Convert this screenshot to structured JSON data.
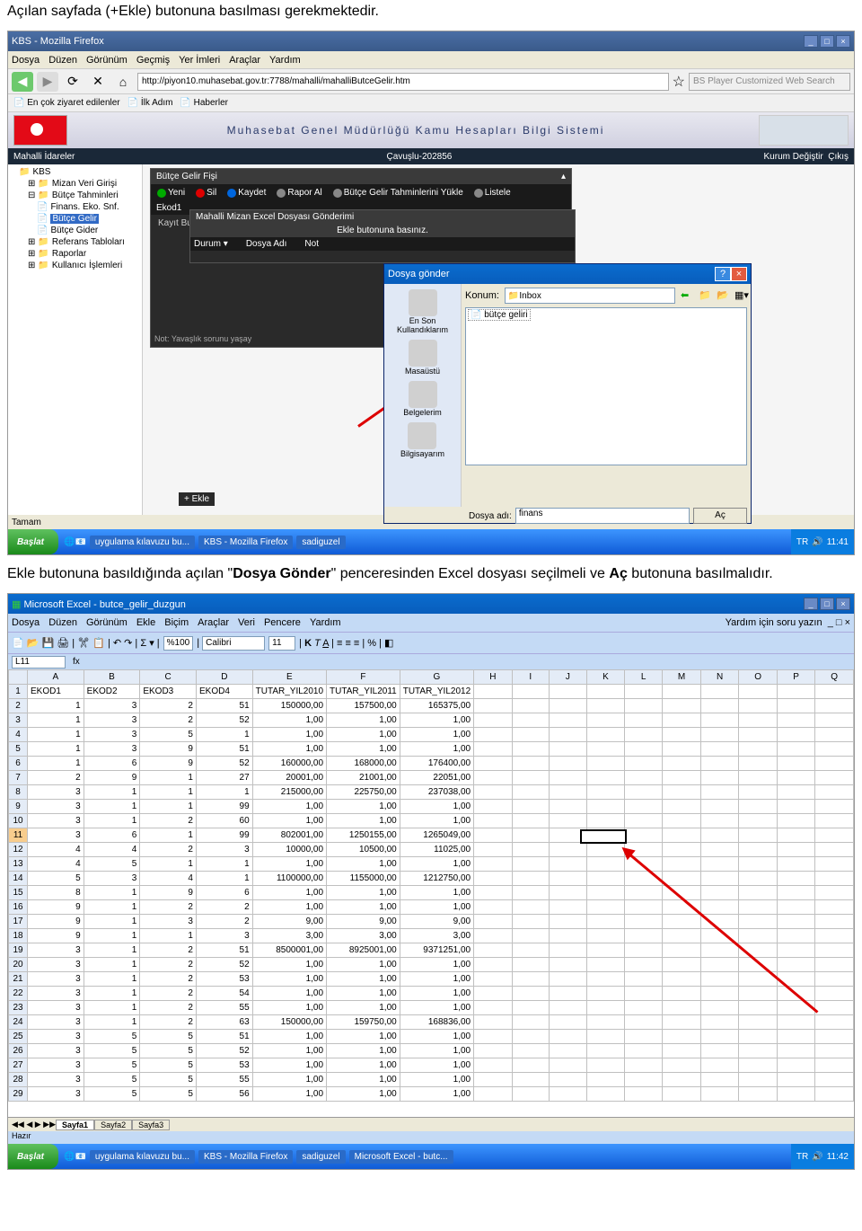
{
  "doc": {
    "para1": "Açılan sayfada (+Ekle) butonuna basılması gerekmektedir.",
    "para2_a": "Ekle butonuna basıldığında açılan \"",
    "para2_b": "Dosya Gönder",
    "para2_c": "\" penceresinden Excel dosyası seçilmeli ve ",
    "para2_d": "Aç",
    "para2_e": " butonuna basılmalıdır."
  },
  "ff": {
    "title": "KBS - Mozilla Firefox",
    "menu": [
      "Dosya",
      "Düzen",
      "Görünüm",
      "Geçmiş",
      "Yer İmleri",
      "Araçlar",
      "Yardım"
    ],
    "url": "http://piyon10.muhasebat.gov.tr:7788/mahalli/mahalliButceGelir.htm",
    "search": "BS Player Customized Web Search",
    "bookmarks": [
      "En çok ziyaret edilenler",
      "İlk Adım",
      "Haberler"
    ],
    "appTitle": "Muhasebat Genel Müdürlüğü Kamu Hesapları Bilgi Sistemi",
    "subLeft": "Mahalli İdareler",
    "subMid": "Çavuşlu-202856",
    "subRightA": "Kurum Değiştir",
    "subRightB": "Çıkış",
    "treeRoot": "KBS",
    "tree": [
      "Mizan Veri Girişi",
      "Bütçe Tahminleri",
      "Finans. Eko. Snf.",
      "Bütçe Gelir",
      "Bütçe Gider",
      "Referans Tabloları",
      "Raporlar",
      "Kullanıcı İşlemleri"
    ],
    "panelTitle": "Bütçe Gelir Fişi",
    "toolbar": [
      "Yeni",
      "Sil",
      "Kaydet",
      "Rapor Al",
      "Bütçe Gelir Tahminlerini Yükle",
      "Listele"
    ],
    "ekod": "Ekod1",
    "modalTitle": "Mahalli Mizan Excel Dosyası Gönderimi",
    "modalMsg": "Ekle butonuna basınız.",
    "modalCols": [
      "Durum ▾",
      "Dosya Adı",
      "Not"
    ],
    "kayit": "Kayıt Bulunamadı.",
    "ekle": "+  Ekle",
    "note": "Not: Yavaşlık sorunu yaşay",
    "status": "Tamam",
    "taskItems": [
      "uygulama kılavuzu bu...",
      "KBS - Mozilla Firefox",
      "sadiguzel"
    ],
    "start": "Başlat",
    "time": "11:41",
    "lang": "TR"
  },
  "dlg": {
    "title": "Dosya gönder",
    "konum": "Konum:",
    "inbox": "Inbox",
    "file": "bütçe geliri",
    "places": [
      "En Son Kullandıklarım",
      "Masaüstü",
      "Belgelerim",
      "Bilgisayarım"
    ],
    "dosyaAdi": "Dosya adı:",
    "filename": "finans",
    "ac": "Aç"
  },
  "excel": {
    "title": "Microsoft Excel - butce_gelir_duzgun",
    "menu": [
      "Dosya",
      "Düzen",
      "Görünüm",
      "Ekle",
      "Biçim",
      "Araçlar",
      "Veri",
      "Pencere",
      "Yardım"
    ],
    "help": "Yardım için soru yazın",
    "zoom": "%100",
    "font": "Calibri",
    "size": "11",
    "nameBox": "L11",
    "cols": [
      "A",
      "B",
      "C",
      "D",
      "E",
      "F",
      "G",
      "H",
      "I",
      "J",
      "K",
      "L",
      "M",
      "N",
      "O",
      "P",
      "Q"
    ],
    "headers": [
      "EKOD1",
      "EKOD2",
      "EKOD3",
      "EKOD4",
      "TUTAR_YIL2010",
      "TUTAR_YIL2011",
      "TUTAR_YIL2012"
    ],
    "rows": [
      [
        1,
        3,
        2,
        51,
        "150000,00",
        "157500,00",
        "165375,00"
      ],
      [
        1,
        3,
        2,
        52,
        "1,00",
        "1,00",
        "1,00"
      ],
      [
        1,
        3,
        5,
        1,
        "1,00",
        "1,00",
        "1,00"
      ],
      [
        1,
        3,
        9,
        51,
        "1,00",
        "1,00",
        "1,00"
      ],
      [
        1,
        6,
        9,
        52,
        "160000,00",
        "168000,00",
        "176400,00"
      ],
      [
        2,
        9,
        1,
        27,
        "20001,00",
        "21001,00",
        "22051,00"
      ],
      [
        3,
        1,
        1,
        1,
        "215000,00",
        "225750,00",
        "237038,00"
      ],
      [
        3,
        1,
        1,
        99,
        "1,00",
        "1,00",
        "1,00"
      ],
      [
        3,
        1,
        2,
        60,
        "1,00",
        "1,00",
        "1,00"
      ],
      [
        3,
        6,
        1,
        99,
        "802001,00",
        "1250155,00",
        "1265049,00"
      ],
      [
        4,
        4,
        2,
        3,
        "10000,00",
        "10500,00",
        "11025,00"
      ],
      [
        4,
        5,
        1,
        1,
        "1,00",
        "1,00",
        "1,00"
      ],
      [
        5,
        3,
        4,
        1,
        "1100000,00",
        "1155000,00",
        "1212750,00"
      ],
      [
        8,
        1,
        9,
        6,
        "1,00",
        "1,00",
        "1,00"
      ],
      [
        9,
        1,
        2,
        2,
        "1,00",
        "1,00",
        "1,00"
      ],
      [
        9,
        1,
        3,
        2,
        "9,00",
        "9,00",
        "9,00"
      ],
      [
        9,
        1,
        1,
        3,
        "3,00",
        "3,00",
        "3,00"
      ],
      [
        3,
        1,
        2,
        51,
        "8500001,00",
        "8925001,00",
        "9371251,00"
      ],
      [
        3,
        1,
        2,
        52,
        "1,00",
        "1,00",
        "1,00"
      ],
      [
        3,
        1,
        2,
        53,
        "1,00",
        "1,00",
        "1,00"
      ],
      [
        3,
        1,
        2,
        54,
        "1,00",
        "1,00",
        "1,00"
      ],
      [
        3,
        1,
        2,
        55,
        "1,00",
        "1,00",
        "1,00"
      ],
      [
        3,
        1,
        2,
        63,
        "150000,00",
        "159750,00",
        "168836,00"
      ],
      [
        3,
        5,
        5,
        51,
        "1,00",
        "1,00",
        "1,00"
      ],
      [
        3,
        5,
        5,
        52,
        "1,00",
        "1,00",
        "1,00"
      ],
      [
        3,
        5,
        5,
        53,
        "1,00",
        "1,00",
        "1,00"
      ],
      [
        3,
        5,
        5,
        55,
        "1,00",
        "1,00",
        "1,00"
      ],
      [
        3,
        5,
        5,
        56,
        "1,00",
        "1,00",
        "1,00"
      ]
    ],
    "tabs": [
      "Sayfa1",
      "Sayfa2",
      "Sayfa3"
    ],
    "ready": "Hazır",
    "taskItems": [
      "uygulama kılavuzu bu...",
      "KBS - Mozilla Firefox",
      "sadiguzel",
      "Microsoft Excel - butc..."
    ],
    "time": "11:42"
  }
}
